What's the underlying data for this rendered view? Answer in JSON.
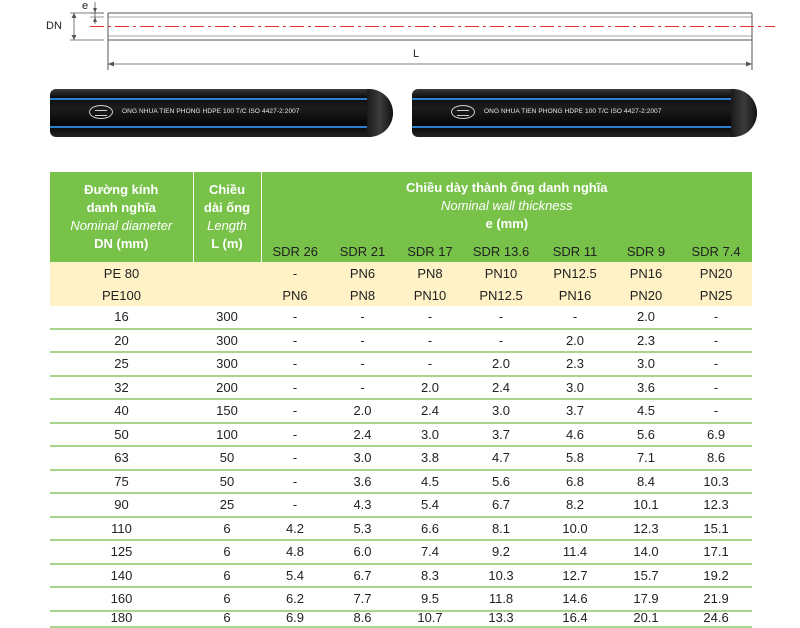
{
  "drawing": {
    "label_e": "e",
    "label_dn": "DN",
    "label_l": "L"
  },
  "pipes": [
    {
      "print": "ONG NHUA TIEN PHONG HDPE 100 T/C ISO 4427-2:2007"
    },
    {
      "print": "ONG NHUA TIEN PHONG HDPE 100 T/C ISO 4427-2:2007"
    }
  ],
  "table": {
    "colors": {
      "header": "#78c24a",
      "pe_rows": "#fff2c7",
      "row_rule": "#a8d48c"
    },
    "header": {
      "dn_vn_1": "Đường kính",
      "dn_vn_2": "danh nghĩa",
      "dn_en": "Nominal diameter",
      "dn_unit": "DN (mm)",
      "len_vn_1": "Chiều",
      "len_vn_2": "dài ống",
      "len_en": "Length",
      "len_unit": "L (m)",
      "wall_vn": "Chiều dày thành ống danh nghĩa",
      "wall_en": "Nominal wall thickness",
      "wall_unit": "e (mm)"
    },
    "sdr": [
      "SDR 26",
      "SDR 21",
      "SDR 17",
      "SDR 13.6",
      "SDR 11",
      "SDR 9",
      "SDR 7.4"
    ],
    "pe80": {
      "label": "PE 80",
      "values": [
        "-",
        "PN6",
        "PN8",
        "PN10",
        "PN12.5",
        "PN16",
        "PN20"
      ]
    },
    "pe100": {
      "label": "PE100",
      "values": [
        "PN6",
        "PN8",
        "PN10",
        "PN12.5",
        "PN16",
        "PN20",
        "PN25"
      ]
    },
    "rows": [
      [
        "16",
        "300",
        "-",
        "-",
        "-",
        "-",
        "-",
        "2.0",
        "-"
      ],
      [
        "20",
        "300",
        "-",
        "-",
        "-",
        "-",
        "2.0",
        "2.3",
        "-"
      ],
      [
        "25",
        "300",
        "-",
        "-",
        "-",
        "2.0",
        "2.3",
        "3.0",
        "-"
      ],
      [
        "32",
        "200",
        "-",
        "-",
        "2.0",
        "2.4",
        "3.0",
        "3.6",
        "-"
      ],
      [
        "40",
        "150",
        "-",
        "2.0",
        "2.4",
        "3.0",
        "3.7",
        "4.5",
        "-"
      ],
      [
        "50",
        "100",
        "-",
        "2.4",
        "3.0",
        "3.7",
        "4.6",
        "5.6",
        "6.9"
      ],
      [
        "63",
        "50",
        "-",
        "3.0",
        "3.8",
        "4.7",
        "5.8",
        "7.1",
        "8.6"
      ],
      [
        "75",
        "50",
        "-",
        "3.6",
        "4.5",
        "5.6",
        "6.8",
        "8.4",
        "10.3"
      ],
      [
        "90",
        "25",
        "-",
        "4.3",
        "5.4",
        "6.7",
        "8.2",
        "10.1",
        "12.3"
      ],
      [
        "110",
        "6",
        "4.2",
        "5.3",
        "6.6",
        "8.1",
        "10.0",
        "12.3",
        "15.1"
      ],
      [
        "125",
        "6",
        "4.8",
        "6.0",
        "7.4",
        "9.2",
        "11.4",
        "14.0",
        "17.1"
      ],
      [
        "140",
        "6",
        "5.4",
        "6.7",
        "8.3",
        "10.3",
        "12.7",
        "15.7",
        "19.2"
      ],
      [
        "160",
        "6",
        "6.2",
        "7.7",
        "9.5",
        "11.8",
        "14.6",
        "17.9",
        "21.9"
      ],
      [
        "180",
        "6",
        "6.9",
        "8.6",
        "10.7",
        "13.3",
        "16.4",
        "20.1",
        "24.6"
      ]
    ]
  }
}
